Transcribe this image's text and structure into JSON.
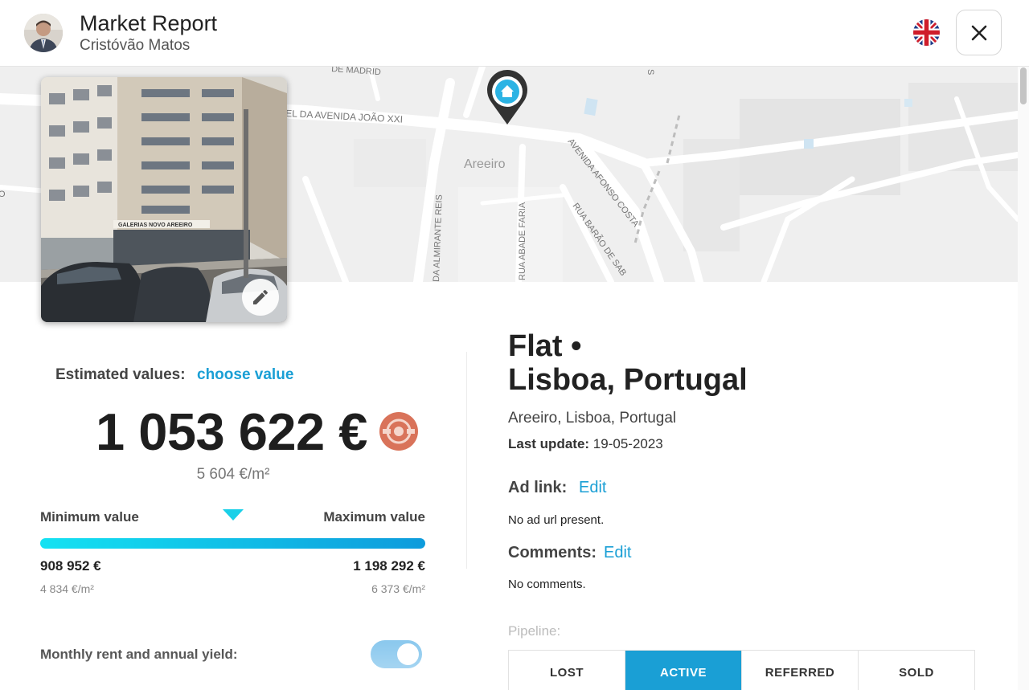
{
  "header": {
    "title": "Market Report",
    "subtitle": "Cristóvão Matos",
    "language_icon": "uk-flag-icon",
    "close_icon": "close-icon"
  },
  "map": {
    "labels": {
      "madrid": "DE MADRID",
      "joao_xxi": "EL DA AVENIDA JOÃO XXI",
      "areeiro": "Areeiro",
      "afonso_costa": "AVENIDA AFONSO COSTA",
      "almirante_reis": "DA ALMIRANTE REIS",
      "abade_faria": "RUA ABADE FARIA",
      "barao_sabrosa": "RUA BARÃO DE SAB",
      "top_right": "S",
      "left_edge": "O"
    },
    "pin_icon": "house-pin-icon"
  },
  "photo": {
    "storefront_sign": "GALERIAS NOVO AREEIRO",
    "edit_icon": "pencil-icon"
  },
  "estimate": {
    "label": "Estimated values:",
    "choose_link": "choose value",
    "value": "1 053 622 €",
    "per_sqm": "5 604 €/m²",
    "min_label": "Minimum value",
    "max_label": "Maximum value",
    "marker_position_fraction": 0.5,
    "min_value": "908 952 €",
    "max_value": "1 198 292 €",
    "min_per_sqm": "4 834 €/m²",
    "max_per_sqm": "6 373 €/m²",
    "rent_label": "Monthly rent and annual yield:",
    "rent_toggle_on": true,
    "value_icon": "valuation-badge-icon"
  },
  "property": {
    "title_line1": "Flat •",
    "title_line2": "Lisboa, Portugal",
    "address": "Areeiro, Lisboa, Portugal",
    "last_update_label": "Last update:",
    "last_update_value": "19-05-2023",
    "ad_link_label": "Ad link:",
    "ad_link_edit": "Edit",
    "ad_link_text": "No ad url present.",
    "comments_label": "Comments:",
    "comments_edit": "Edit",
    "comments_text": "No comments.",
    "pipeline_label": "Pipeline:",
    "pipeline": [
      "LOST",
      "ACTIVE",
      "REFERRED",
      "SOLD"
    ],
    "pipeline_active": "ACTIVE"
  },
  "colors": {
    "accent": "#1a9fd5",
    "bar_start": "#14e2f2",
    "bar_end": "#0e9bdc",
    "toggle": "#8cc9ee",
    "badge": "#d9735a"
  }
}
